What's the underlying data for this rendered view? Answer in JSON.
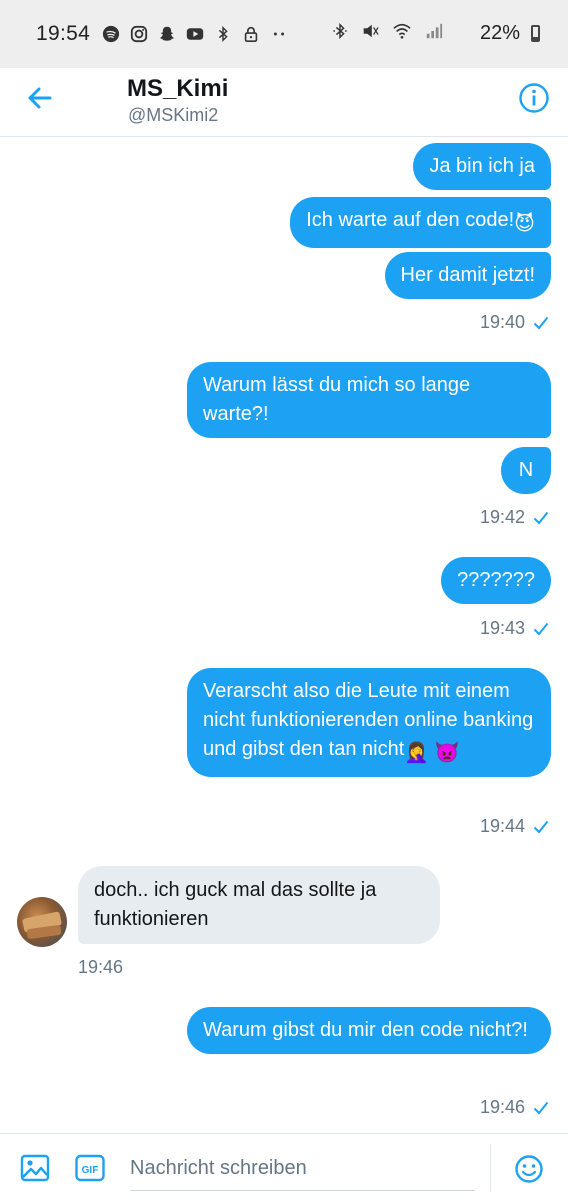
{
  "status_bar": {
    "time": "19:54",
    "battery": "22%",
    "icons_left": [
      "spotify-icon",
      "instagram-icon",
      "snapchat-icon",
      "youtube-icon",
      "bluetooth-icon",
      "lock-icon",
      "more-dots-icon"
    ],
    "icons_right": [
      "bluetooth-icon",
      "mute-icon",
      "wifi-icon",
      "signal-icon"
    ]
  },
  "header": {
    "name": "MS_Kimi",
    "handle": "@MSKimi2"
  },
  "messages": [
    {
      "side": "out",
      "text": "Ja bin ich ja"
    },
    {
      "side": "out",
      "text": "Ich warte auf den code!",
      "emoji": "😈"
    },
    {
      "side": "out",
      "text": "Her damit jetzt!"
    },
    {
      "side": "out",
      "text": "Warum lässt du mich so lange warte?!"
    },
    {
      "side": "out",
      "text": "N"
    },
    {
      "side": "out",
      "text": "???????"
    },
    {
      "side": "out",
      "text": "Verarscht also die Leute mit einem nicht funktionierenden online banking und gibst den tan nicht",
      "emoji": "🤦‍♀️ 👿"
    },
    {
      "side": "in",
      "text": "doch.. ich guck mal das sollte ja funktionieren"
    },
    {
      "side": "out",
      "text": "Warum gibst du mir den code nicht?!"
    }
  ],
  "timestamps": [
    "19:40",
    "19:42",
    "19:43",
    "19:44",
    "19:46",
    "19:46"
  ],
  "compose": {
    "placeholder": "Nachricht schreiben",
    "gif_label": "GIF"
  },
  "colors": {
    "accent": "#1da1f2",
    "incoming_bubble": "#e6ecf0",
    "secondary_text": "#657786"
  }
}
